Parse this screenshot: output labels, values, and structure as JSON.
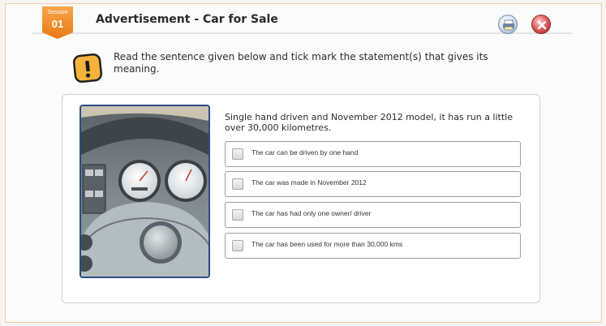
{
  "header": {
    "session_label": "Session",
    "session_number": "01",
    "title": "Advertisement - Car for Sale",
    "print_icon": "print-icon",
    "close_icon": "close-icon"
  },
  "instruction": {
    "icon": "warning-exclamation-icon",
    "text": "Read the sentence given below and tick mark the statement(s) that gives its meaning."
  },
  "question": {
    "image": "car-dashboard-illustration",
    "statement": "Single hand driven and November 2012 model, it has run a little over 30,000 kilometres.",
    "options": [
      {
        "label": "The car can be driven by one hand",
        "checked": false
      },
      {
        "label": "The car was made in November 2012",
        "checked": false
      },
      {
        "label": "The car has had only one owner/ driver",
        "checked": false
      },
      {
        "label": "The car has been used for more than 30,000 kms",
        "checked": false
      }
    ]
  },
  "colors": {
    "accent_orange": "#f08a2a",
    "image_border": "#2f4a86",
    "close_red": "#e0635f"
  }
}
